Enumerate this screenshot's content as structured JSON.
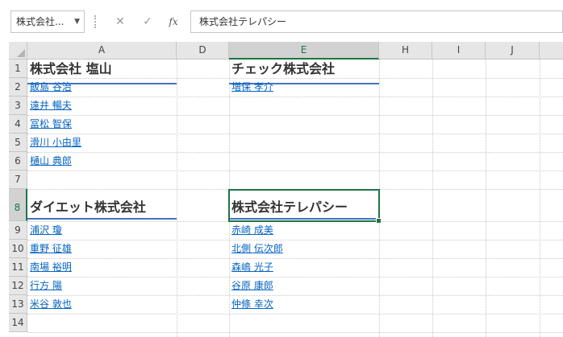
{
  "name_box": {
    "value": "株式会社..."
  },
  "formula_bar": {
    "cancel_glyph": "✕",
    "enter_glyph": "✓",
    "fx_glyph": "fx",
    "content": "株式会社テレパシー"
  },
  "columns": [
    "A",
    "D",
    "E",
    "H",
    "I",
    "J"
  ],
  "rows": [
    "1",
    "2",
    "3",
    "4",
    "5",
    "6",
    "7",
    "8",
    "9",
    "10",
    "11",
    "12",
    "13",
    "14"
  ],
  "selected_column": "E",
  "selected_row": "8",
  "cells": {
    "A1": "株式会社 塩山",
    "A2": "飯島 谷治",
    "A3": "遠井 暢夫",
    "A4": "冨松 智保",
    "A5": "滑川 小由里",
    "A6": "樋山 典郎",
    "A8": "ダイエット株式会社",
    "A9": "浦沢 瓊",
    "A10": "重野 征雄",
    "A11": "南場 裕明",
    "A12": "行方 陽",
    "A13": "米谷 敦也",
    "E1": "チェック株式会社",
    "E2": "増保 孝介",
    "E8": "株式会社テレパシー",
    "E9": "赤崎 成美",
    "E10": "北側 伝次郎",
    "E11": "森嶋 光子",
    "E12": "谷原 康郎",
    "E13": "仲條 幸次"
  },
  "colors": {
    "link": "#0563c1",
    "heading_underline": "#4472c4",
    "selection": "#217346"
  }
}
